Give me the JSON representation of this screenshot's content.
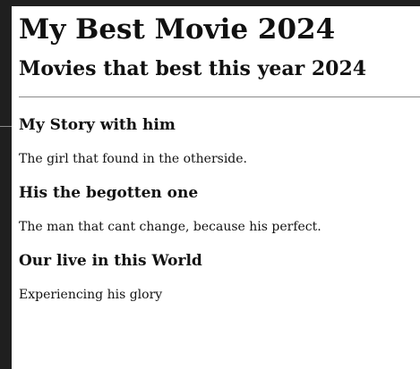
{
  "page": {
    "title": "My Best Movie 2024",
    "subtitle": "Movies that best this year 2024"
  },
  "movies": [
    {
      "title": "My Story with him",
      "description": "The girl that found in the otherside."
    },
    {
      "title": "His the begotten one",
      "description": "The man that cant change, because his perfect."
    },
    {
      "title": "Our live in this World",
      "description": "Experiencing his glory"
    }
  ]
}
